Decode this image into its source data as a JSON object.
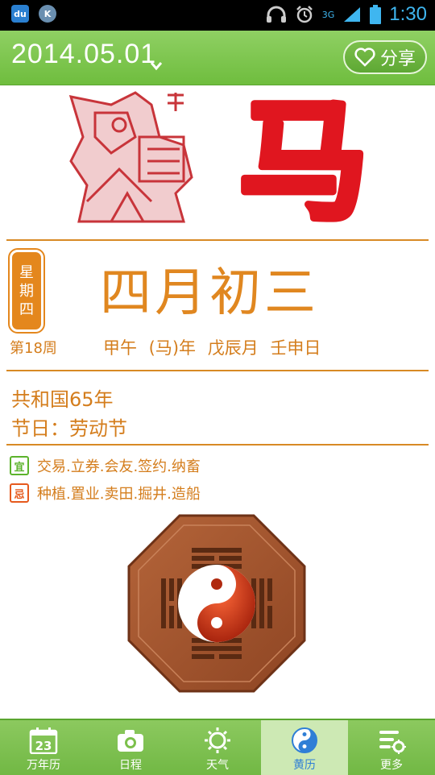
{
  "status_bar": {
    "left_icons": [
      "du",
      "K"
    ],
    "network": "3G",
    "time": "1:30"
  },
  "header": {
    "date": "2014.05.01",
    "share_label": "分享"
  },
  "zodiac": {
    "character": "马",
    "art_icon": "horse-papercut-icon"
  },
  "day": {
    "weekday": [
      "星",
      "期",
      "四"
    ],
    "lunar_date": "四月初三",
    "week_number": "第18周",
    "ganzhi": "甲午 (马)年  戊辰月  壬申日"
  },
  "info": {
    "republic_year": "共和国65年",
    "holiday": "节日：劳动节"
  },
  "almanac": {
    "yi_label": "宜",
    "yi_text": "交易.立券.会友.签约.纳畜",
    "ji_label": "忌",
    "ji_text": "种植.置业.卖田.掘井.造船"
  },
  "tabs": [
    {
      "label": "万年历",
      "icon": "calendar-icon",
      "calendar_day": "23"
    },
    {
      "label": "日程",
      "icon": "camera-icon"
    },
    {
      "label": "天气",
      "icon": "sun-icon"
    },
    {
      "label": "黄历",
      "icon": "yin-yang-icon",
      "active": true
    },
    {
      "label": "更多",
      "icon": "settings-list-icon"
    }
  ],
  "colors": {
    "header_green": "#7cc04c",
    "accent_orange": "#d88a25",
    "zodiac_red": "#e0161f",
    "active_tab_blue": "#2f7fd6"
  }
}
